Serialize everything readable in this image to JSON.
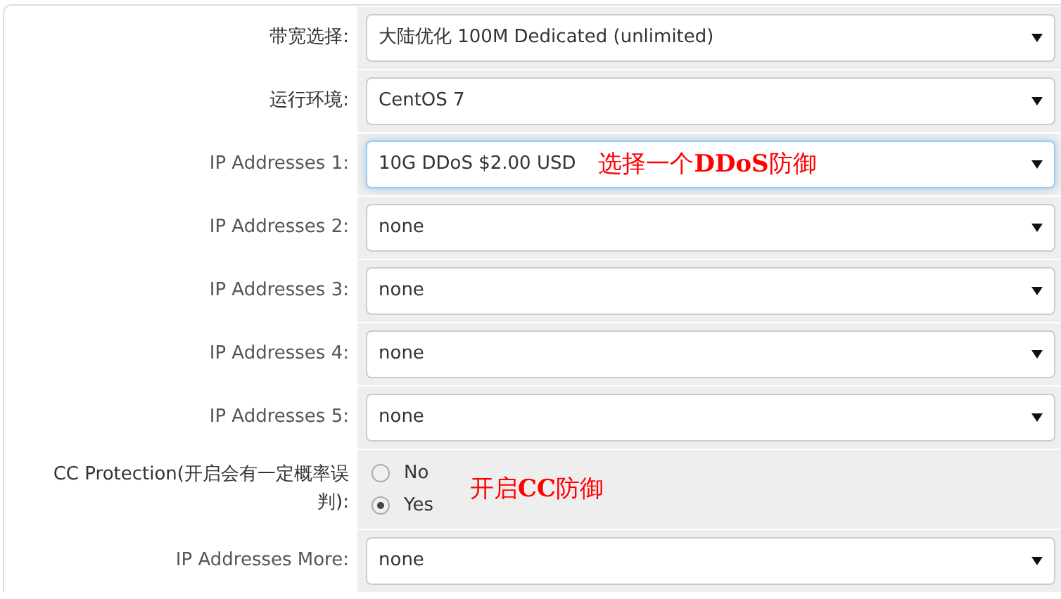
{
  "rows": [
    {
      "kind": "select",
      "label": "带宽选择:",
      "muted": false,
      "value": "大陆优化 100M Dedicated (unlimited)",
      "focused": false
    },
    {
      "kind": "select",
      "label": "运行环境:",
      "muted": false,
      "value": "CentOS 7",
      "focused": false
    },
    {
      "kind": "select",
      "label": "IP Addresses 1:",
      "muted": true,
      "value": "10G DDoS $2.00 USD",
      "focused": true,
      "annotation": "选择一个**DDoS**防御"
    },
    {
      "kind": "select",
      "label": "IP Addresses 2:",
      "muted": true,
      "value": "none",
      "focused": false
    },
    {
      "kind": "select",
      "label": "IP Addresses 3:",
      "muted": true,
      "value": "none",
      "focused": false
    },
    {
      "kind": "select",
      "label": "IP Addresses 4:",
      "muted": true,
      "value": "none",
      "focused": false
    },
    {
      "kind": "select",
      "label": "IP Addresses 5:",
      "muted": true,
      "value": "none",
      "focused": false
    },
    {
      "kind": "radio",
      "label": "CC Protection(开启会有一定概率误判):",
      "muted": false,
      "options": [
        {
          "label": "No",
          "selected": false
        },
        {
          "label": "Yes",
          "selected": true
        }
      ],
      "annotation": "开启**CC**防御"
    },
    {
      "kind": "select",
      "label": "IP Addresses More:",
      "muted": true,
      "value": "none",
      "focused": false
    }
  ]
}
